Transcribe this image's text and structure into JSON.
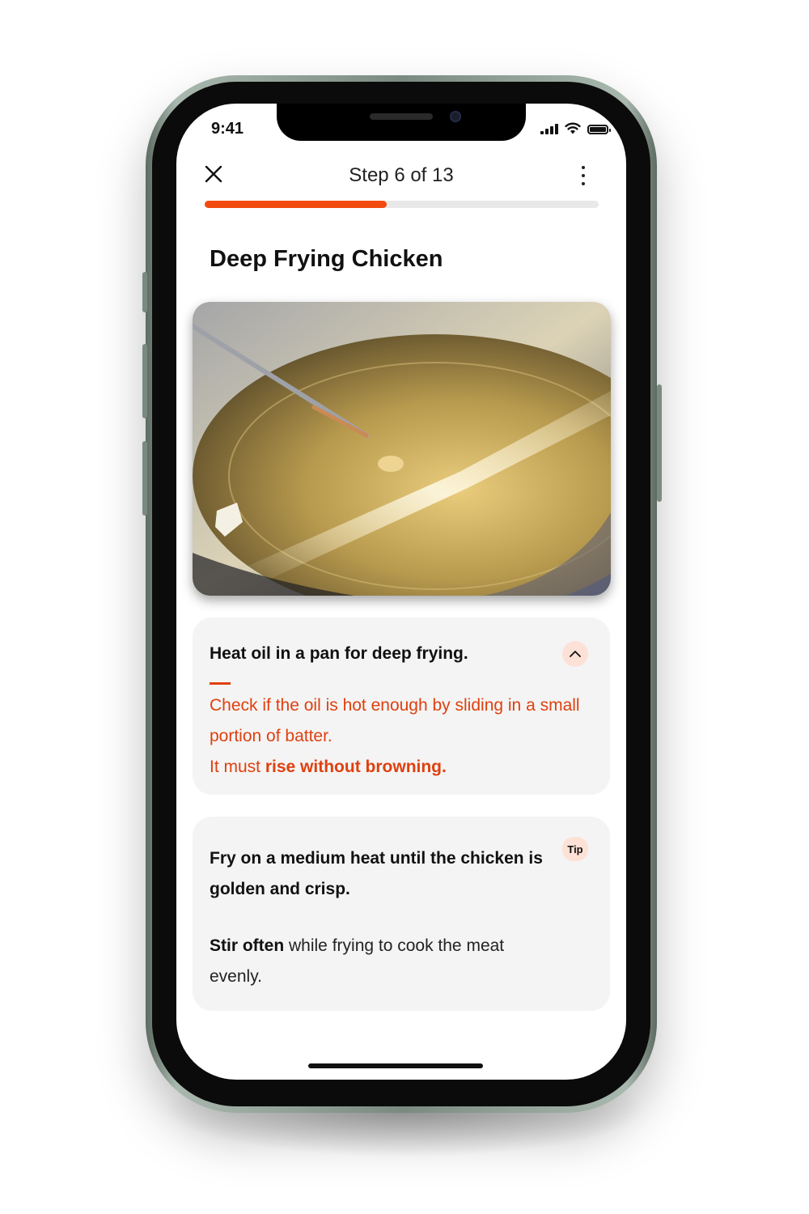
{
  "status_bar": {
    "time": "9:41"
  },
  "header": {
    "step_label": "Step 6 of 13",
    "progress_fraction": 0.4615
  },
  "page": {
    "title": "Deep Frying Chicken"
  },
  "instruction_card": {
    "heading": "Heat oil in a pan for deep frying.",
    "detail_line1": "Check if the oil is hot enough by sliding in a small portion of batter.",
    "detail_prefix": "It must ",
    "detail_emphasis": "rise without browning."
  },
  "tip_card": {
    "badge": "Tip",
    "heading": "Fry on a medium heat until the chicken is golden and crisp.",
    "body_emphasis": "Stir often",
    "body_rest": " while frying to cook the meat evenly."
  },
  "colors": {
    "accent": "#f24b0f",
    "accent_text": "#e0400f",
    "badge_bg": "#fde1d7",
    "card_bg": "#f4f4f4"
  },
  "icons": {
    "close": "close-icon",
    "menu": "more-vertical-icon",
    "collapse": "chevron-up-icon"
  }
}
